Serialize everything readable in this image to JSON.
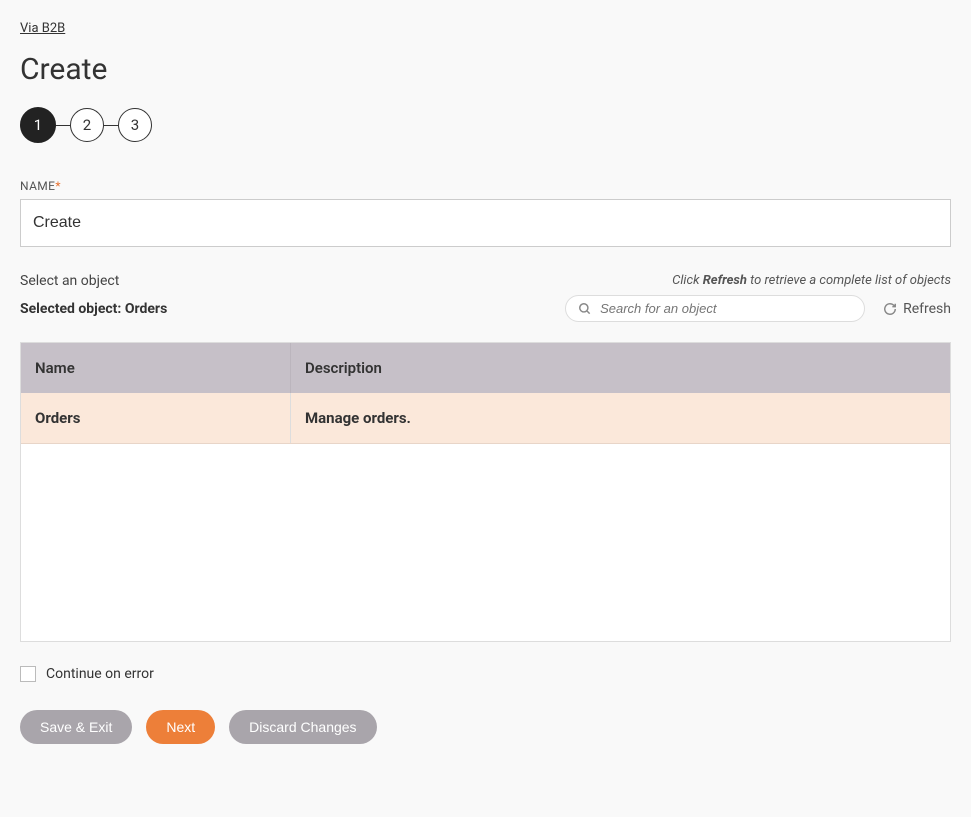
{
  "breadcrumb": "Via B2B",
  "pageTitle": "Create",
  "stepper": {
    "steps": [
      "1",
      "2",
      "3"
    ],
    "active": 0
  },
  "nameField": {
    "label": "NAME",
    "value": "Create"
  },
  "objectSection": {
    "selectLabel": "Select an object",
    "hintPrefix": "Click ",
    "hintBold": "Refresh",
    "hintSuffix": " to retrieve a complete list of objects",
    "selectedPrefix": "Selected object: ",
    "selectedValue": "Orders",
    "searchPlaceholder": "Search for an object",
    "refreshLabel": "Refresh"
  },
  "table": {
    "headers": {
      "name": "Name",
      "description": "Description"
    },
    "rows": [
      {
        "name": "Orders",
        "description": "Manage orders."
      }
    ]
  },
  "continueOnError": {
    "label": "Continue on error",
    "checked": false
  },
  "buttons": {
    "saveExit": "Save & Exit",
    "next": "Next",
    "discard": "Discard Changes"
  }
}
